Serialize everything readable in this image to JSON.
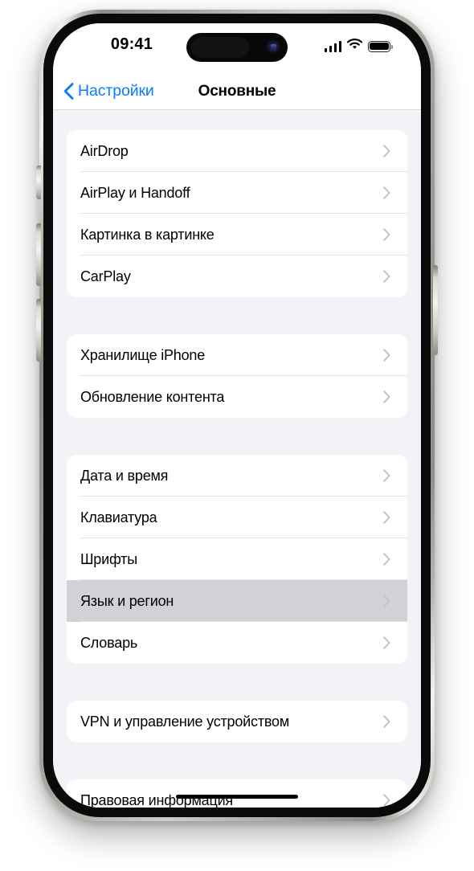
{
  "device": {
    "name": "iphone-15-pro",
    "frame_color": "#cfcdc6",
    "bezel_color": "#0a0a0a",
    "side_buttons": [
      {
        "name": "action-button",
        "side": "left"
      },
      {
        "name": "volume-up-button",
        "side": "left"
      },
      {
        "name": "volume-down-button",
        "side": "left"
      },
      {
        "name": "power-button",
        "side": "right"
      }
    ]
  },
  "status_bar": {
    "time": "09:41",
    "cellular_icon": "signal-bars-icon",
    "cellular_bars": 4,
    "wifi_icon": "wifi-icon",
    "battery_icon": "battery-icon",
    "battery_level": 100,
    "dynamic_island": "dynamic-island",
    "camera_icon": "front-camera-icon"
  },
  "nav_bar": {
    "back_icon": "chevron-left-icon",
    "back_label": "Настройки",
    "title": "Основные",
    "accent_color": "#0a7cff"
  },
  "colors": {
    "page_background": "#f2f2f7",
    "card_background": "#ffffff",
    "separator": "#e4e4e8",
    "selected_row": "#d1d1d6",
    "chevron": "#c4c4c7",
    "label_text": "#000000"
  },
  "groups": [
    {
      "id": "group-connectivity",
      "rows": [
        {
          "label": "AirDrop",
          "chevron": "chevron-right-icon",
          "selected": false
        },
        {
          "label": "AirPlay и Handoff",
          "chevron": "chevron-right-icon",
          "selected": false
        },
        {
          "label": "Картинка в картинке",
          "chevron": "chevron-right-icon",
          "selected": false
        },
        {
          "label": "CarPlay",
          "chevron": "chevron-right-icon",
          "selected": false
        }
      ]
    },
    {
      "id": "group-storage",
      "rows": [
        {
          "label": "Хранилище iPhone",
          "chevron": "chevron-right-icon",
          "selected": false
        },
        {
          "label": "Обновление контента",
          "chevron": "chevron-right-icon",
          "selected": false
        }
      ]
    },
    {
      "id": "group-localization",
      "rows": [
        {
          "label": "Дата и время",
          "chevron": "chevron-right-icon",
          "selected": false
        },
        {
          "label": "Клавиатура",
          "chevron": "chevron-right-icon",
          "selected": false
        },
        {
          "label": "Шрифты",
          "chevron": "chevron-right-icon",
          "selected": false
        },
        {
          "label": "Язык и регион",
          "chevron": "chevron-right-icon",
          "selected": true
        },
        {
          "label": "Словарь",
          "chevron": "chevron-right-icon",
          "selected": false
        }
      ]
    },
    {
      "id": "group-vpn",
      "rows": [
        {
          "label": "VPN и управление устройством",
          "chevron": "chevron-right-icon",
          "selected": false
        }
      ]
    },
    {
      "id": "group-legal",
      "rows": [
        {
          "label": "Правовая информация",
          "chevron": "chevron-right-icon",
          "selected": false
        }
      ]
    }
  ],
  "home_indicator": "home-indicator"
}
